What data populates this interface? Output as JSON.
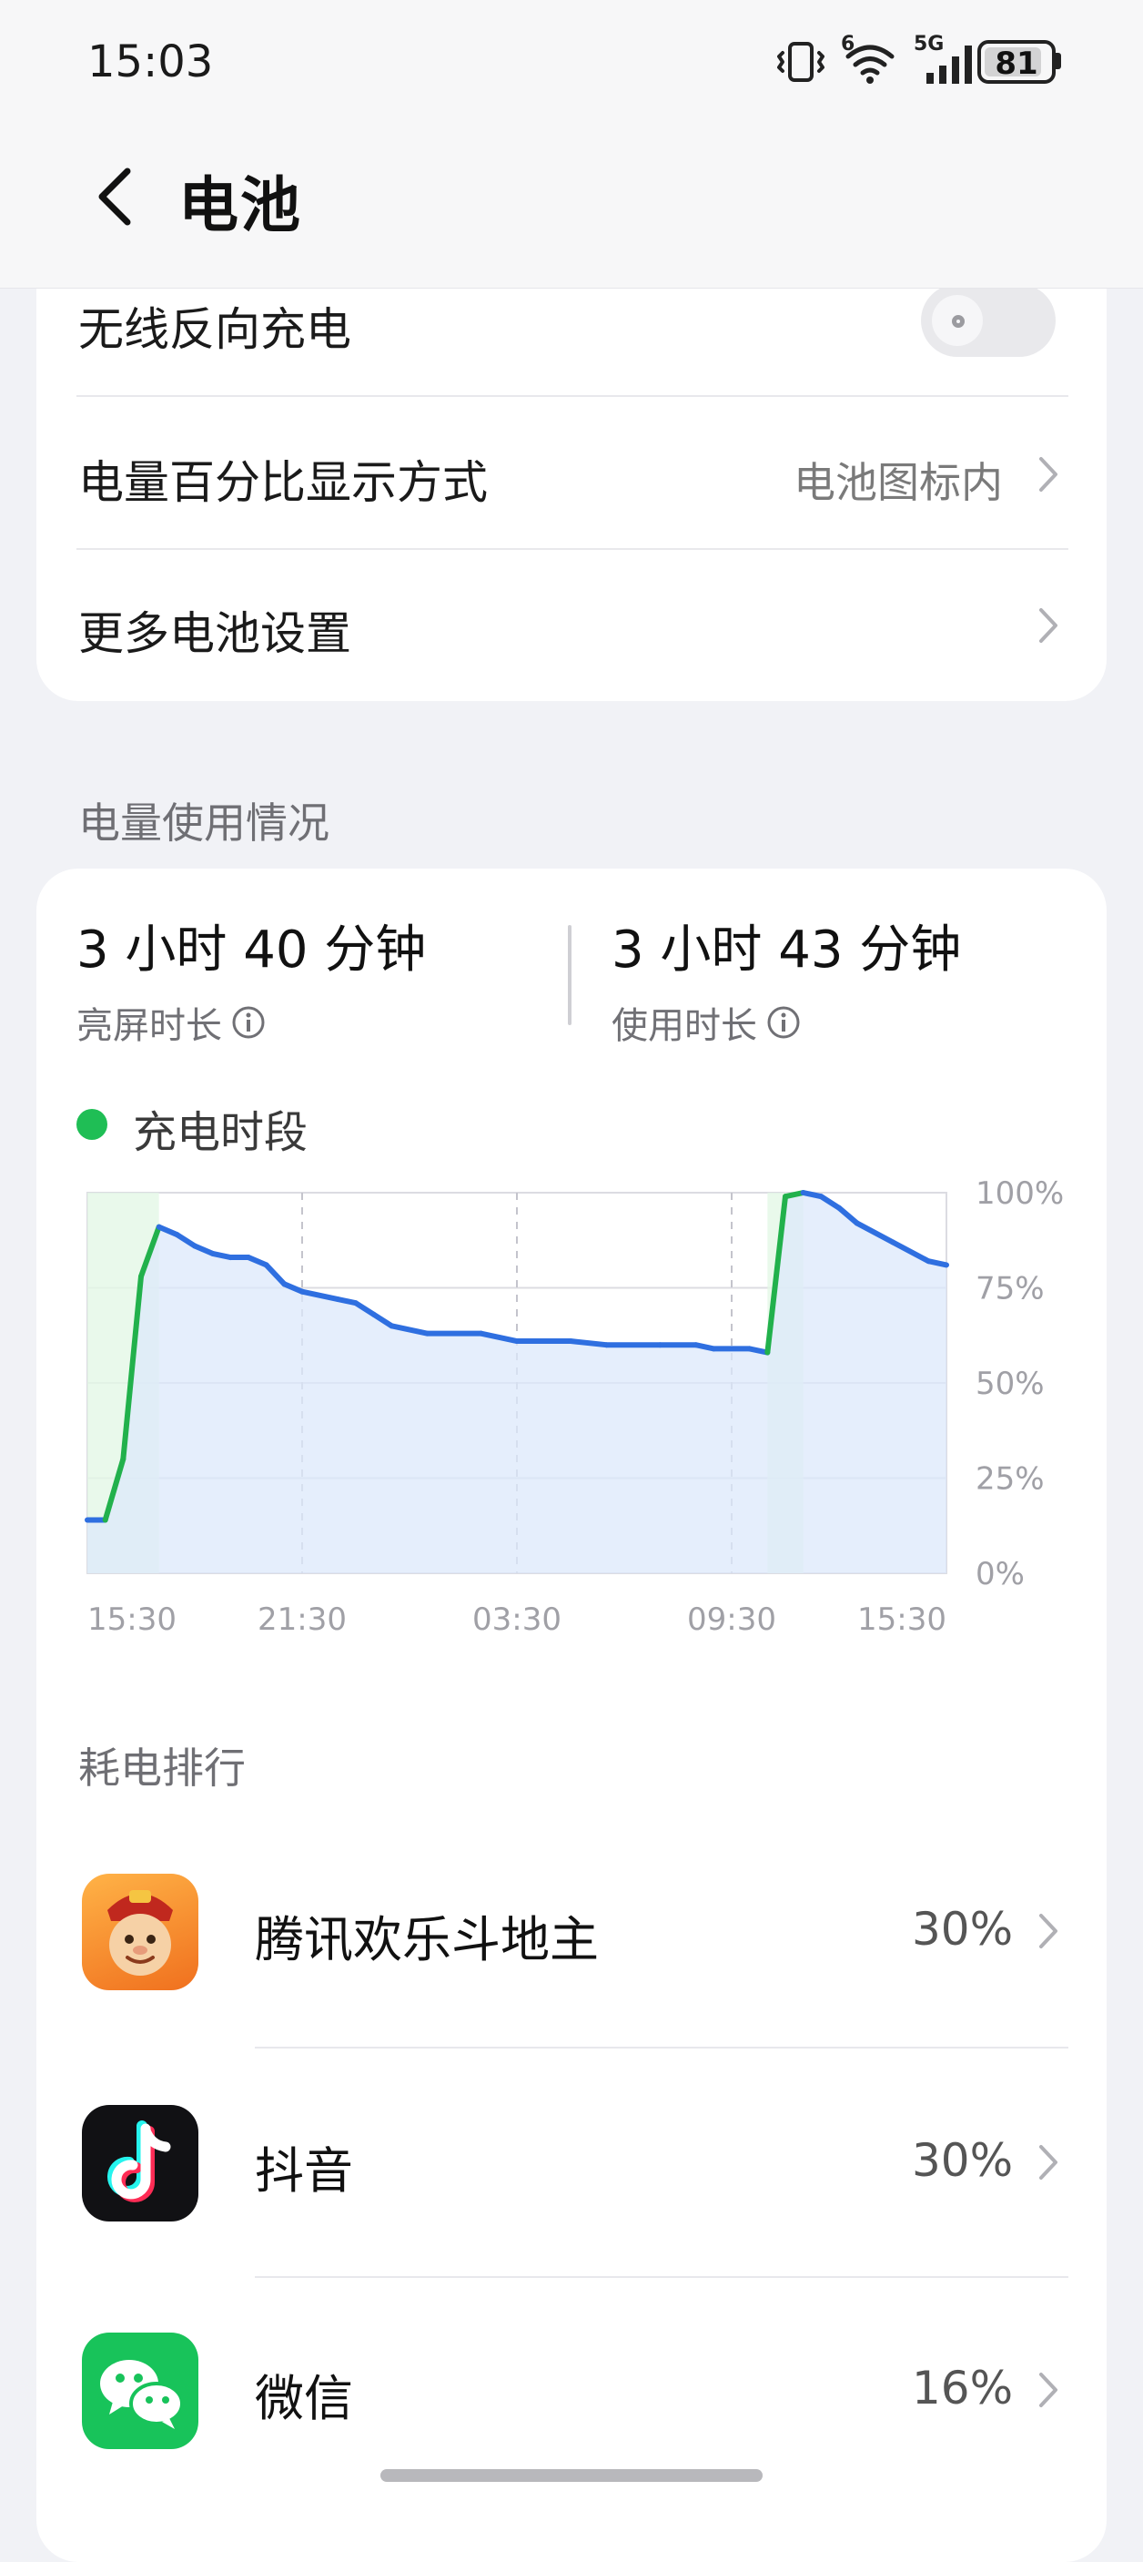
{
  "status_bar": {
    "time": "15:03",
    "network": "5G",
    "wifi_badge": "6",
    "battery_level": "81",
    "icons": [
      "vibrate-icon",
      "wifi-icon",
      "signal-icon",
      "battery-icon"
    ]
  },
  "header": {
    "title": "电池"
  },
  "settings": {
    "wireless_reverse": {
      "label": "无线反向充电",
      "enabled": false
    },
    "percentage_display": {
      "label": "电量百分比显示方式",
      "value": "电池图标内"
    },
    "more_settings": {
      "label": "更多电池设置"
    }
  },
  "usage": {
    "section_title": "电量使用情况",
    "screen_time": {
      "value": "3 小时 40 分钟",
      "label": "亮屏时长"
    },
    "usage_time": {
      "value": "3 小时 43 分钟",
      "label": "使用时长"
    },
    "legend": "充电时段"
  },
  "chart_data": {
    "type": "area",
    "x_ticks": [
      "15:30",
      "21:30",
      "03:30",
      "09:30",
      "15:30"
    ],
    "y_ticks": [
      "100%",
      "75%",
      "50%",
      "25%",
      "0%"
    ],
    "ylim": [
      0,
      100
    ],
    "x_range_hours": [
      0,
      24
    ],
    "grid": true,
    "colors": {
      "line": "#2f6fe0",
      "charging": "#22b14c",
      "fill": "#dce8fb",
      "charging_fill": "#e4f7e6"
    },
    "charging_periods": [
      [
        0,
        2.0
      ],
      [
        19.0,
        20.0
      ]
    ],
    "series": [
      {
        "points": [
          [
            0,
            14
          ],
          [
            0.5,
            14
          ],
          [
            1.0,
            30
          ],
          [
            1.5,
            78
          ],
          [
            2.0,
            91
          ],
          [
            2.5,
            89
          ],
          [
            3.0,
            86
          ],
          [
            3.5,
            84
          ],
          [
            4.0,
            83
          ],
          [
            4.5,
            83
          ],
          [
            5.0,
            81
          ],
          [
            5.5,
            76
          ],
          [
            6.0,
            74
          ],
          [
            7.0,
            72
          ],
          [
            7.5,
            71
          ],
          [
            8.0,
            68
          ],
          [
            8.5,
            65
          ],
          [
            9.5,
            63
          ],
          [
            11.0,
            63
          ],
          [
            12.0,
            61
          ],
          [
            13.5,
            61
          ],
          [
            14.5,
            60
          ],
          [
            16.0,
            60
          ],
          [
            17.0,
            60
          ],
          [
            17.5,
            59
          ],
          [
            18.5,
            59
          ],
          [
            19.0,
            58
          ],
          [
            19.5,
            99
          ],
          [
            20.0,
            100
          ],
          [
            20.5,
            99
          ],
          [
            21.0,
            96
          ],
          [
            21.5,
            92
          ],
          [
            22.5,
            87
          ],
          [
            23.5,
            82
          ],
          [
            24,
            81
          ]
        ]
      }
    ]
  },
  "ranking": {
    "section_title": "耗电排行",
    "apps": [
      {
        "name": "腾讯欢乐斗地主",
        "percent": "30%",
        "icon": "doudizhu-app-icon"
      },
      {
        "name": "抖音",
        "percent": "30%",
        "icon": "douyin-app-icon"
      },
      {
        "name": "微信",
        "percent": "16%",
        "icon": "wechat-app-icon"
      }
    ]
  }
}
